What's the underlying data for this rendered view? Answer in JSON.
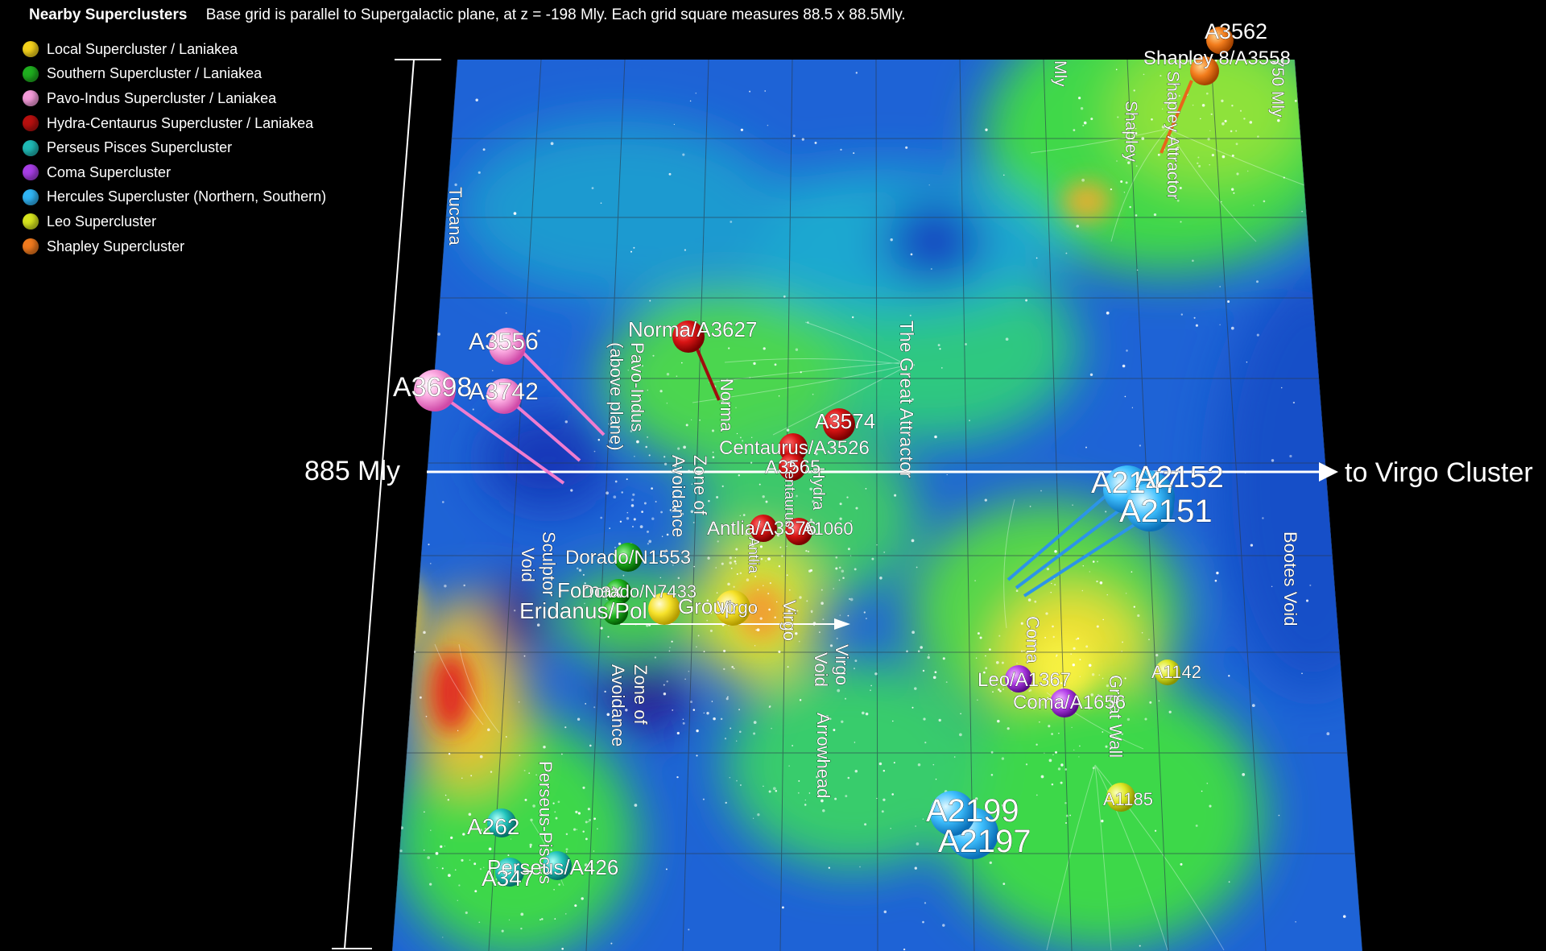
{
  "header": {
    "title": "Nearby Superclusters",
    "description": "Base grid is parallel to Supergalactic plane, at z = -198 Mly. Each grid square measures 88.5 x 88.5Mly."
  },
  "legend": [
    {
      "label": "Local Supercluster / Laniakea",
      "color": "#f4d21c"
    },
    {
      "label": "Southern Supercluster / Laniakea",
      "color": "#1fae1f"
    },
    {
      "label": "Pavo-Indus Supercluster / Laniakea",
      "color": "#f39ad8"
    },
    {
      "label": "Hydra-Centaurus Supercluster / Laniakea",
      "color": "#b8100f"
    },
    {
      "label": "Perseus Pisces Supercluster",
      "color": "#1fb8b4"
    },
    {
      "label": "Coma Supercluster",
      "color": "#a73ee6"
    },
    {
      "label": "Hercules Supercluster (Northern, Southern)",
      "color": "#30b4f4"
    },
    {
      "label": "Leo Supercluster",
      "color": "#d6e41e"
    },
    {
      "label": "Shapley Supercluster",
      "color": "#f07a1e"
    }
  ],
  "scale": {
    "label": "885 Mly"
  },
  "arrow": {
    "label": "to Virgo Cluster"
  },
  "regions": {
    "tucana": "Tucana",
    "great_attractor": "The Great Attractor",
    "pavo_indus": "Pavo-Indus",
    "above_plane": "(above plane)",
    "norma": "Norma",
    "zoa1_a": "Zone of",
    "zoa1_b": "Avoidance",
    "sculptor_a": "Sculptor",
    "sculptor_b": "Void",
    "zoa2_a": "Zone of",
    "zoa2_b": "Avoidance",
    "virgo": "Virgo",
    "virgo_void_a": "Virgo",
    "virgo_void_b": "Void",
    "arrowhead": "Arrowhead",
    "coma": "Coma",
    "great_wall": "Great Wall",
    "bootes_void": "Bootes Void",
    "perseus_pisces": "Perseus-Pisces",
    "hydra": "Hydra",
    "centaurus_v": "Centaurus",
    "antlia_v": "Antlia",
    "shapley": "Shapley",
    "shapley_attractor": "Shapley Attractor",
    "mly_top": "Mly",
    "mly_top2": "750 Mly"
  },
  "clusters": {
    "a3562": "A3562",
    "shapley8": "Shapley 8/A3558",
    "norma": "Norma/A3627",
    "a3556": "A3556",
    "a3698": "A3698",
    "a3742": "A3742",
    "a3574": "A3574",
    "centaurus": "Centaurus/A3526",
    "a3565": "A3565",
    "antlia": "Antlia/A3376",
    "a1060": "A1060",
    "dorado": "Dorado/N1553",
    "fornax": "Fornax",
    "dorado2": "Dorado/N7433",
    "eridanus": "Eridanus/Pol",
    "group": "Group",
    "virgo": "Virgo",
    "a2152": "A2152",
    "a2147": "A2147",
    "a2151": "A2151",
    "leo": "Leo/A1367",
    "coma": "Coma/A1656",
    "a1142": "A1142",
    "a1185": "A1185",
    "a2199": "A2199",
    "a2197": "A2197",
    "a262": "A262",
    "perseus": "Perseus/A426",
    "a347": "A347"
  }
}
